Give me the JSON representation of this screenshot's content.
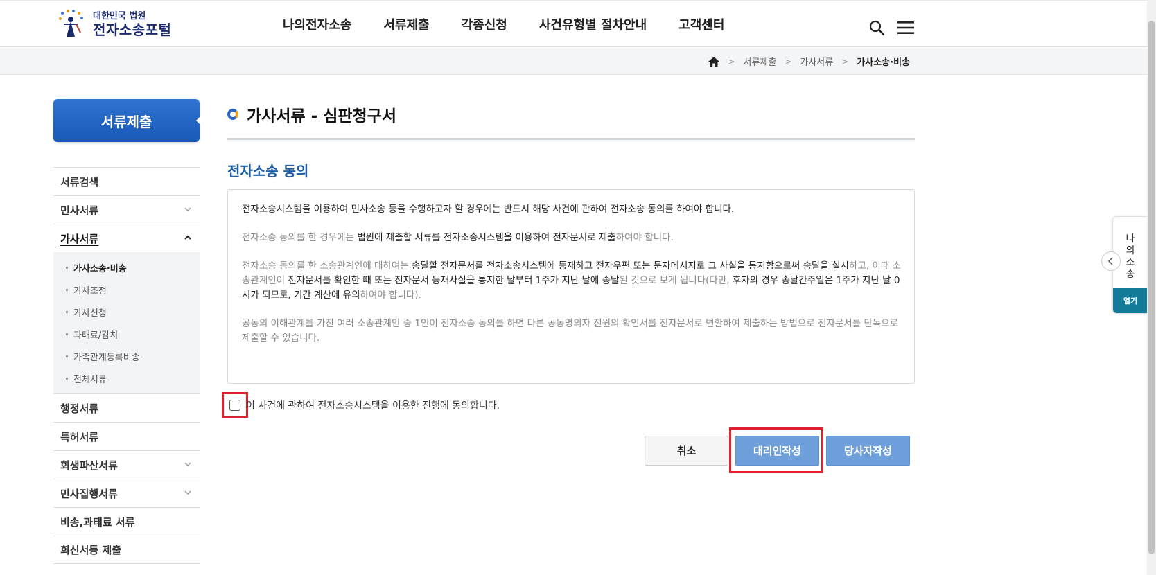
{
  "logo": {
    "sub": "대한민국 법원",
    "main": "전자소송포털"
  },
  "gnb": {
    "items": [
      "나의전자소송",
      "서류제출",
      "각종신청",
      "사건유형별 절차안내",
      "고객센터"
    ]
  },
  "breadcrumb": {
    "items": [
      "서류제출",
      "가사서류"
    ],
    "current": "가사소송·비송"
  },
  "lnb": {
    "title": "서류제출",
    "items": [
      {
        "label": "서류검색"
      },
      {
        "label": "민사서류"
      },
      {
        "label": "가사서류"
      },
      {
        "label": "행정서류"
      },
      {
        "label": "특허서류"
      },
      {
        "label": "회생파산서류"
      },
      {
        "label": "민사집행서류"
      },
      {
        "label": "비송,과태료 서류"
      },
      {
        "label": "회신서등 제출"
      }
    ],
    "sub_items": [
      "가사소송·비송",
      "가사조정",
      "가사신청",
      "과태료/감치",
      "가족관계등록비송",
      "전체서류"
    ]
  },
  "main": {
    "page_title": "가사서류 - 심판청구서",
    "section_title": "전자소송 동의",
    "notice": {
      "p1": "전자소송시스템을 이용하여 민사소송 등을 수행하고자 할 경우에는 반드시 해당 사건에 관하여 전자소송 동의를 하여야 합니다.",
      "p2_a": "전자소송 동의를 한 경우에는 ",
      "p2_b": "법원에 제출할 서류를 전자소송시스템을 이용하여 전자문서로 제출",
      "p2_c": "하여야 합니다.",
      "p3_a": "전자소송 동의를 한 소송관계인에 대하여는 ",
      "p3_b": "송달할 전자문서를 전자소송시스템에 등재하고 전자우편 또는 문자메시지로 그 사실을 통지함으로써 송달을 실시",
      "p3_c": "하고, 이때 소송관계인이 ",
      "p3_d": "전자문서를 확인한 때 또는 전자문서 등재사실을 통지한 날부터 1주가 지난 날에 송달",
      "p3_e": "된 것으로 보게 됩니다(다만, ",
      "p3_f": "후자의 경우 송달간주일은 1주가 지난 날 0시가 되므로, 기간 계산에 유의",
      "p3_g": "하여야 합니다).",
      "p4": "공동의 이해관계를 가진 여러 소송관계인 중 1인이 전자소송 동의를 하면 다른 공동명의자 전원의 확인서를 전자문서로 변환하여 제출하는 방법으로 전자문서를 단독으로 제출할 수 있습니다."
    },
    "agree_label": "이 사건에 관하여 전자소송시스템을 이용한 진행에 동의합니다.",
    "buttons": {
      "cancel": "취소",
      "agent": "대리인작성",
      "party": "당사자작성"
    }
  },
  "quick_panel": {
    "label_chars": [
      "나",
      "의",
      "소",
      "송"
    ],
    "open": "열기"
  },
  "colors": {
    "brand_blue": "#1958b8",
    "section_blue": "#1d5fa8",
    "button_blue": "#6f9fdb",
    "highlight_red": "#e0202a",
    "quick_teal": "#137b97"
  }
}
